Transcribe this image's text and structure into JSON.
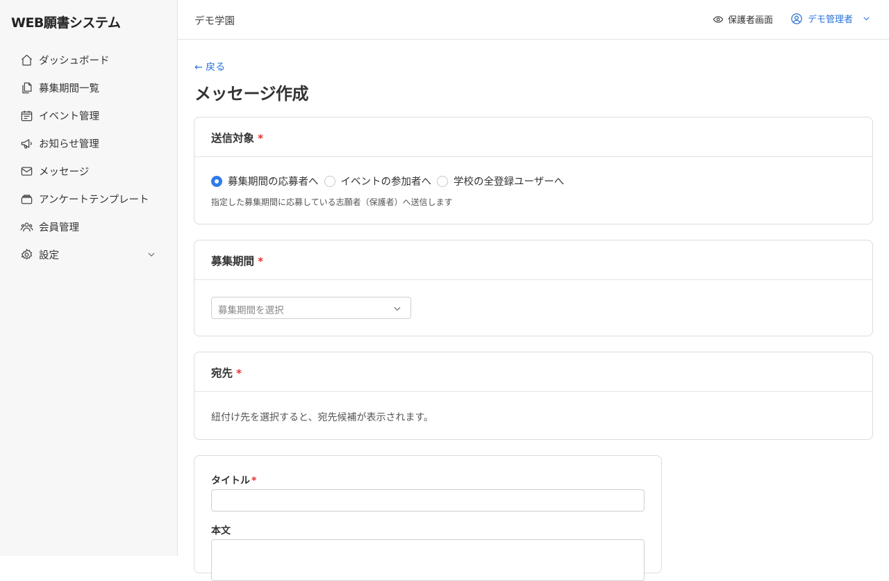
{
  "app": {
    "title": "WEB願書システム"
  },
  "colors": {
    "accent": "#2f7bea",
    "link": "#2a72d8",
    "required": "#e23434"
  },
  "sidebar": {
    "items": [
      {
        "label": "ダッシュボード",
        "icon": "home-icon"
      },
      {
        "label": "募集期間一覧",
        "icon": "documents-icon"
      },
      {
        "label": "イベント管理",
        "icon": "calendar-icon"
      },
      {
        "label": "お知らせ管理",
        "icon": "megaphone-icon"
      },
      {
        "label": "メッセージ",
        "icon": "mail-icon"
      },
      {
        "label": "アンケートテンプレート",
        "icon": "tray-icon"
      },
      {
        "label": "会員管理",
        "icon": "users-icon"
      },
      {
        "label": "設定",
        "icon": "gear-icon"
      }
    ]
  },
  "header": {
    "school": "デモ学園",
    "guardian_view": "保護者画面",
    "user": "デモ管理者"
  },
  "page": {
    "back": "← 戻る",
    "title": "メッセージ作成"
  },
  "target": {
    "heading": "送信対象",
    "required": "*",
    "options": [
      {
        "label": "募集期間の応募者へ",
        "selected": true
      },
      {
        "label": "イベントの参加者へ",
        "selected": false
      },
      {
        "label": "学校の全登録ユーザーへ",
        "selected": false
      }
    ],
    "hint": "指定した募集期間に応募している志願者（保護者）へ送信します"
  },
  "period": {
    "heading": "募集期間",
    "required": "*",
    "placeholder": "募集期間を選択"
  },
  "recipients": {
    "heading": "宛先",
    "required": "*",
    "description": "紐付け先を選択すると、宛先候補が表示されます。"
  },
  "form": {
    "title_label": "タイトル",
    "title_required": "*",
    "title_value": "",
    "body_label": "本文",
    "body_value": ""
  }
}
